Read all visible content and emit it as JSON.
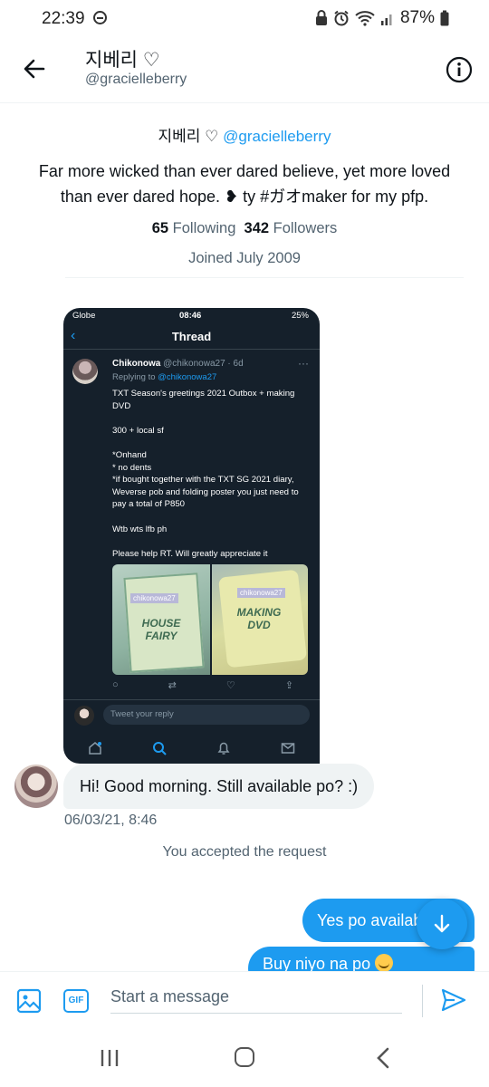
{
  "status_bar": {
    "time": "22:39",
    "battery": "87%"
  },
  "header": {
    "name": "지베리 ♡",
    "handle": "@gracielleberry"
  },
  "profile": {
    "name": "지베리 ♡",
    "handle": "@gracielleberry",
    "bio": "Far more wicked than ever dared believe, yet more loved than ever dared hope. ❥ ty #ガオmaker for my pfp.",
    "following_count": "65",
    "following_label": "Following",
    "followers_count": "342",
    "followers_label": "Followers",
    "joined": "Joined July 2009"
  },
  "shared_image": {
    "carrier": "Globe",
    "time": "08:46",
    "battery": "25%",
    "title": "Thread",
    "author": "Chikonowa",
    "author_meta": "@chikonowa27 · 6d",
    "replying_prefix": "Replying to",
    "replying_handle": "@chikonowa27",
    "body": "TXT Season's greetings 2021 Outbox + making DVD\n\n300 + local sf\n\n*Onhand\n* no dents\n*if bought together with the TXT SG 2021 diary, Weverse pob and folding poster you just need to pay a total of P850\n\nWtb wts lfb ph\n\nPlease help RT. Will greatly appreciate it",
    "photo1_tag": "chikonowa27",
    "photo1_text": "HOUSE FAIRY",
    "photo2_tag": "chikonowa27",
    "photo2_text": "MAKING DVD",
    "reply_placeholder": "Tweet your reply"
  },
  "messages": {
    "received_text": "Hi! Good morning. Still available po? :)",
    "received_time": "06/03/21, 8:46",
    "system_note": "You accepted the request",
    "sent_1": "Yes po availab",
    "sent_2": "Buy niyo na po"
  },
  "composer": {
    "placeholder": "Start a message",
    "gif_label": "GIF"
  },
  "colors": {
    "accent": "#1d9bf0",
    "secondary_text": "#536471",
    "bubble_received": "#eff3f4",
    "shared_bg": "#15202b"
  },
  "icons": [
    "back-arrow-icon",
    "info-icon",
    "photo-icon",
    "gif-icon",
    "send-icon",
    "scroll-down-icon",
    "smile-emoji-icon"
  ]
}
